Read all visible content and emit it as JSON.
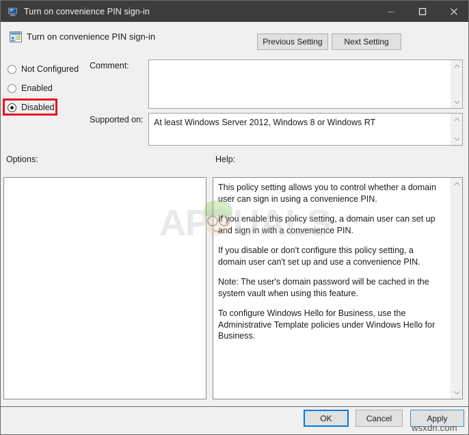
{
  "window": {
    "title": "Turn on convenience PIN sign-in",
    "icon": "policy-monitor-icon",
    "controls": {
      "minimize": "minimize-icon",
      "maximize": "maximize-icon",
      "close": "close-icon"
    }
  },
  "header": {
    "icon": "policy-setting-icon",
    "title": "Turn on convenience PIN sign-in",
    "previous_setting": "Previous Setting",
    "next_setting": "Next Setting"
  },
  "state_options": [
    {
      "label": "Not Configured",
      "selected": false
    },
    {
      "label": "Enabled",
      "selected": false
    },
    {
      "label": "Disabled",
      "selected": true
    }
  ],
  "highlight": {
    "target": "Disabled",
    "color": "#e81123"
  },
  "fields": {
    "comment_label": "Comment:",
    "comment_value": "",
    "supported_label": "Supported on:",
    "supported_value": "At least Windows Server 2012, Windows 8 or Windows RT"
  },
  "panels": {
    "options_label": "Options:",
    "options_content": "",
    "help_label": "Help:",
    "help_paragraphs": [
      "This policy setting allows you to control whether a domain user can sign in using a convenience PIN.",
      "If you enable this policy setting, a domain user can set up and sign in with a convenience PIN.",
      "If you disable or don't configure this policy setting, a domain user can't set up and use a convenience PIN.",
      "Note: The user's domain password will be cached in the system vault when using this feature.",
      "To configure Windows Hello for Business, use the Administrative Template policies under Windows Hello for Business."
    ]
  },
  "footer": {
    "ok": "OK",
    "cancel": "Cancel",
    "apply": "Apply"
  },
  "watermarks": {
    "brand": "APPUALS",
    "site": "wsxdn.com"
  },
  "colors": {
    "titlebar": "#3c3c3c",
    "dialog_bg": "#f0f0f0",
    "accent_focus": "#0078d7",
    "highlight_red": "#e81123"
  }
}
